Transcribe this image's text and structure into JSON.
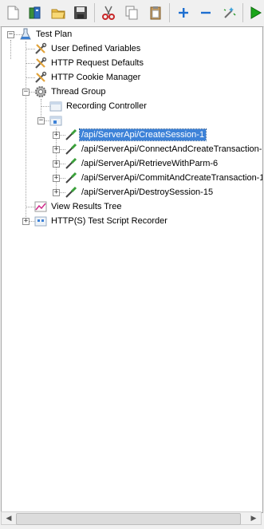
{
  "toolbar": {
    "buttons": [
      {
        "name": "new",
        "icon": "new-document-icon"
      },
      {
        "name": "templates",
        "icon": "templates-book-icon"
      },
      {
        "name": "open",
        "icon": "open-folder-icon"
      },
      {
        "name": "save",
        "icon": "save-disk-icon"
      },
      {
        "name": "cut",
        "icon": "scissors-icon"
      },
      {
        "name": "copy",
        "icon": "copy-icon"
      },
      {
        "name": "paste",
        "icon": "paste-clipboard-icon"
      },
      {
        "name": "expand",
        "icon": "plus-icon"
      },
      {
        "name": "collapse",
        "icon": "minus-icon"
      },
      {
        "name": "toggle",
        "icon": "toggle-wand-icon"
      },
      {
        "name": "start",
        "icon": "play-icon"
      }
    ],
    "colors": {
      "expand": "#1e6fd0",
      "collapse": "#1e6fd0",
      "start": "#1aa51a",
      "cut": "#c8282a"
    }
  },
  "tree": {
    "test_plan": "Test Plan",
    "user_defined_variables": "User Defined Variables",
    "http_request_defaults": "HTTP Request Defaults",
    "http_cookie_manager": "HTTP Cookie Manager",
    "thread_group": "Thread Group",
    "recording_controller": "Recording Controller",
    "samplers": [
      "/api/ServerApi/CreateSession-1",
      "/api/ServerApi/ConnectAndCreateTransaction-",
      "/api/ServerApi/RetrieveWithParm-6",
      "/api/ServerApi/CommitAndCreateTransaction-1",
      "/api/ServerApi/DestroySession-15"
    ],
    "selected_index": 0,
    "view_results_tree": "View Results Tree",
    "test_script_recorder": "HTTP(S) Test Script Recorder"
  },
  "colors": {
    "selection": "#3d82d8"
  }
}
